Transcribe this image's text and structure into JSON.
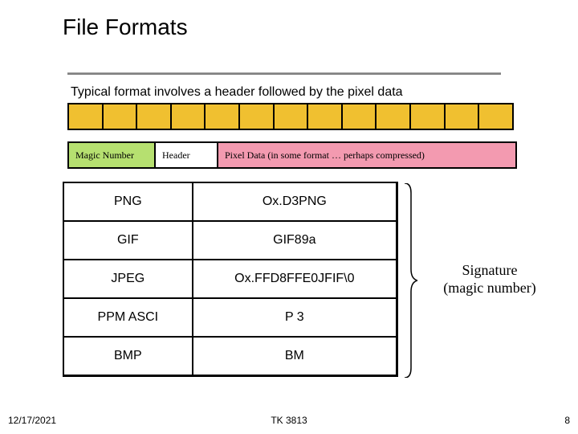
{
  "title": "File Formats",
  "intro": "Typical format involves a header followed by the pixel data",
  "structure": {
    "magic": "Magic Number",
    "header": "Header",
    "pixel": "Pixel Data (in some format … perhaps compressed)"
  },
  "formats": [
    {
      "name": "PNG",
      "sig": "Ox.D3PNG"
    },
    {
      "name": "GIF",
      "sig": "GIF89a"
    },
    {
      "name": "JPEG",
      "sig": "Ox.FFD8FFE0JFIF\\0"
    },
    {
      "name": "PPM ASCI",
      "sig": "P 3"
    },
    {
      "name": "BMP",
      "sig": "BM"
    }
  ],
  "annotation": {
    "line1": "Signature",
    "line2": "(magic number)"
  },
  "footer": {
    "date": "12/17/2021",
    "center": "TK 3813",
    "page": "8"
  },
  "colors": {
    "yellow": "#f0c030",
    "green": "#b6e070",
    "pink": "#f39ab0"
  }
}
